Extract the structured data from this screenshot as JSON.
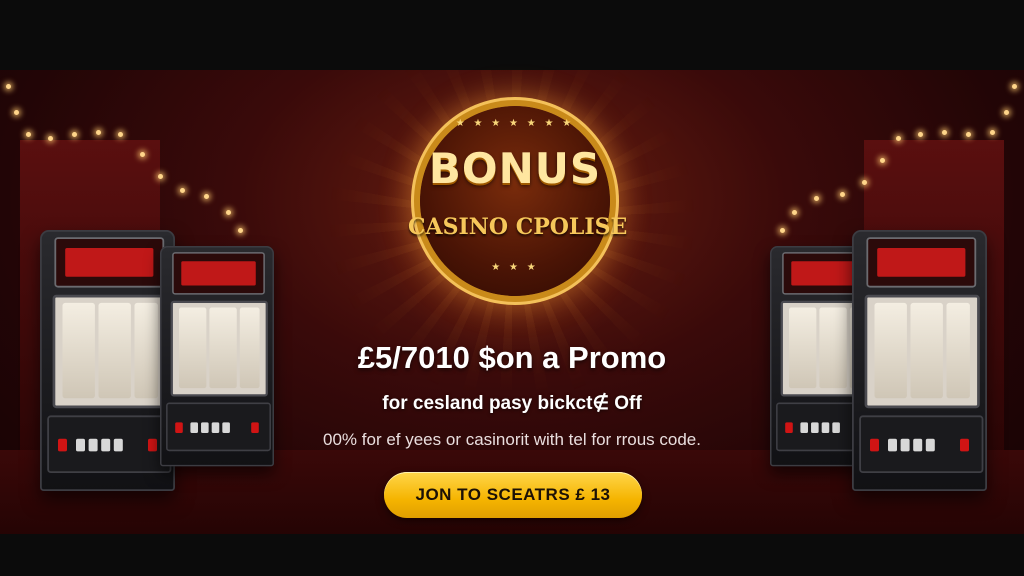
{
  "badge": {
    "title": "BONUS",
    "subtitle": "CASINO CPOLISE",
    "ring_top": "★ ★ ★ ★ ★ ★ ★",
    "ring_bottom": "★ ★ ★"
  },
  "promo": {
    "headline": "£5/7010 $on a Promo",
    "subline": "for cesland pasy bickct∉ Off",
    "description": "00% for ef yees or casinorit with tel for rrous code.",
    "cta_label": "JON TO SCEATRS £ 13"
  },
  "colors": {
    "accent": "#f5b400",
    "background": "#3a0a0a",
    "badge_gold": "#f4c15a"
  }
}
